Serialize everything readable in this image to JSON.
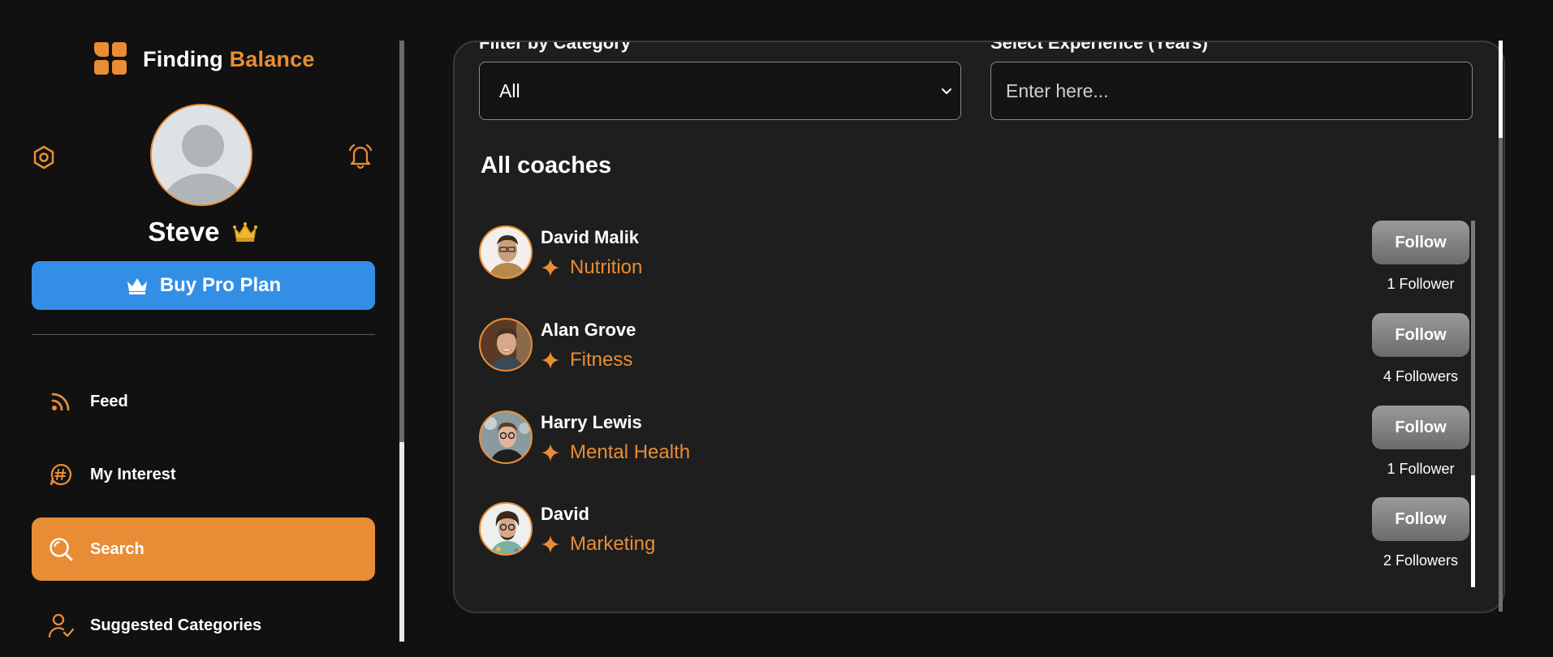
{
  "brand": {
    "name_part1": "Finding",
    "name_part2": "Balance",
    "accent_color": "#e88d35"
  },
  "user": {
    "name": "Steve"
  },
  "sidebar": {
    "pro_button_label": "Buy Pro Plan",
    "items": [
      {
        "label": "Feed",
        "icon": "rss-icon"
      },
      {
        "label": "My Interest",
        "icon": "hashtag-chat-icon"
      },
      {
        "label": "Search",
        "icon": "search-icon",
        "active": true
      },
      {
        "label": "Suggested Categories",
        "icon": "user-check-icon"
      }
    ]
  },
  "filters": {
    "category_label": "Filter by Category",
    "category_value": "All",
    "experience_label": "Select Experience (Years)",
    "experience_placeholder": "Enter here..."
  },
  "main": {
    "section_title": "All coaches",
    "coaches": [
      {
        "name": "David Malik",
        "category": "Nutrition",
        "button": "Follow",
        "followers": "1 Follower"
      },
      {
        "name": "Alan Grove",
        "category": "Fitness",
        "button": "Follow",
        "followers": "4 Followers"
      },
      {
        "name": "Harry Lewis",
        "category": "Mental Health",
        "button": "Follow",
        "followers": "1 Follower"
      },
      {
        "name": "David",
        "category": "Marketing",
        "button": "Follow",
        "followers": "2 Followers"
      }
    ]
  },
  "colors": {
    "background": "#111111",
    "panel": "#1e1e1e",
    "primary_blue": "#338fe6",
    "orange": "#e88d35"
  }
}
